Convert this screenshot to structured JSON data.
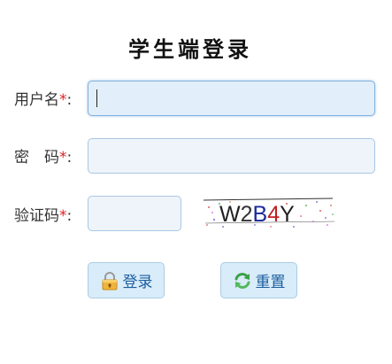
{
  "page": {
    "title": "学生端登录"
  },
  "form": {
    "username": {
      "label": "用户名",
      "required_mark": "*",
      "colon": ":",
      "value": ""
    },
    "password": {
      "label": "密　码",
      "required_mark": "*",
      "colon": ":",
      "value": ""
    },
    "captcha": {
      "label": "验证码",
      "required_mark": "*",
      "colon": ":",
      "value": "",
      "image_text": "W2B4Y"
    }
  },
  "buttons": {
    "login": {
      "label": "登录",
      "icon": "lock-icon"
    },
    "reset": {
      "label": "重置",
      "icon": "refresh-icon"
    }
  },
  "colors": {
    "accent": "#1c5fa0",
    "required": "#e02020",
    "button_bg": "#d9ecf9",
    "input_border": "#a9c7e4"
  }
}
